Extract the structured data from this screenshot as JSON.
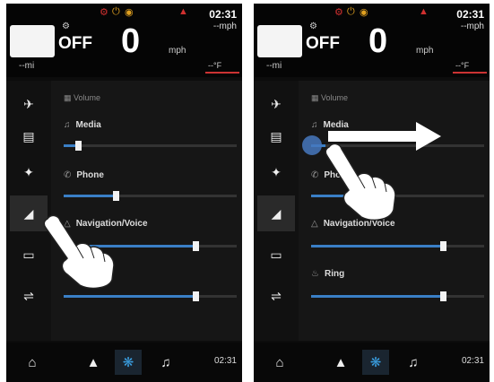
{
  "status": {
    "clock": "02:31",
    "speed_unit": "--mph",
    "gear_status": "OFF",
    "speed": "0",
    "speed_label": "mph",
    "trip": "--mi",
    "temperature": "--°F"
  },
  "sidebar": {
    "items": [
      {
        "icon": "motorcycle-icon"
      },
      {
        "icon": "dashboard-icon"
      },
      {
        "icon": "wrench-icon"
      },
      {
        "icon": "speaker-icon"
      },
      {
        "icon": "display-icon"
      },
      {
        "icon": "toggle-settings-icon"
      }
    ]
  },
  "volume": {
    "section_title": "Volume",
    "sliders": [
      {
        "label": "Media",
        "level": 0.08
      },
      {
        "label": "Phone",
        "level": 0.3
      },
      {
        "label": "Navigation/Voice",
        "level": 0.76
      },
      {
        "label": "Ring",
        "level": 0.76
      }
    ]
  },
  "bottombar": {
    "items": [
      "home-icon",
      "navigation-arrow-icon",
      "settings-gear-icon",
      "music-note-icon"
    ],
    "time": "02:31"
  },
  "colors": {
    "accent": "#3a7fc6",
    "active_icon": "#3a9ee0",
    "warning_red": "#d0302f",
    "warning_orange": "#e0a020"
  }
}
